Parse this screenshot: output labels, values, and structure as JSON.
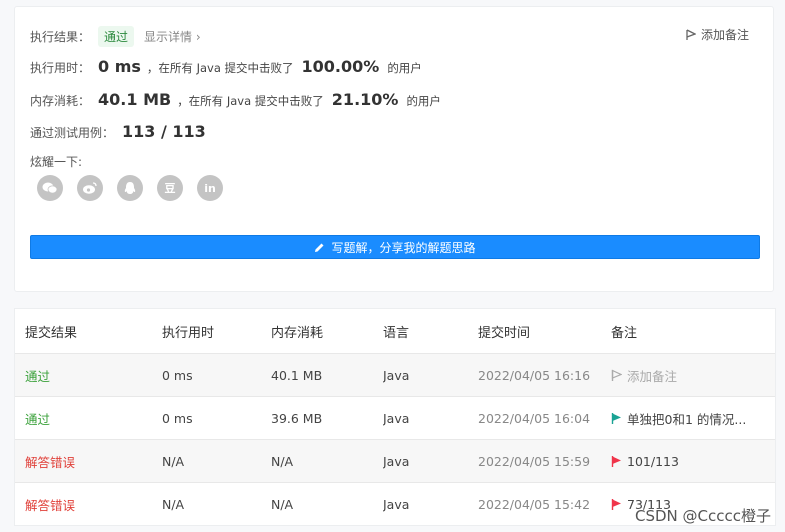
{
  "result": {
    "label": "执行结果：",
    "status": "通过",
    "details_link": "显示详情 ›",
    "add_note": "添加备注"
  },
  "runtime": {
    "label": "执行用时：",
    "value": "0 ms",
    "mid_text": "，在所有 Java 提交中击败了",
    "percent": "100.00%",
    "suffix": "的用户"
  },
  "memory": {
    "label": "内存消耗：",
    "value": "40.1 MB",
    "mid_text": "，在所有 Java 提交中击败了",
    "percent": "21.10%",
    "suffix": "的用户"
  },
  "testcases": {
    "label": "通过测试用例：",
    "value": "113 / 113"
  },
  "share": {
    "label": "炫耀一下:",
    "icons": [
      "wechat-icon",
      "weibo-icon",
      "qq-icon",
      "douban-icon",
      "linkedin-icon"
    ],
    "douban_glyph": "豆",
    "linkedin_glyph": "in"
  },
  "solution_button": "写题解，分享我的解题思路",
  "submissions": {
    "headers": [
      "提交结果",
      "执行用时",
      "内存消耗",
      "语言",
      "提交时间",
      "备注"
    ],
    "rows": [
      {
        "result": "通过",
        "runtime": "0 ms",
        "memory": "40.1 MB",
        "lang": "Java",
        "time": "2022/04/05 16:16",
        "note": "添加备注",
        "flag": "#aaaaaa"
      },
      {
        "result": "通过",
        "runtime": "0 ms",
        "memory": "39.6 MB",
        "lang": "Java",
        "time": "2022/04/05 16:04",
        "note": "单独把0和1 的情况...",
        "flag": "#1aa394"
      },
      {
        "result": "解答错误",
        "runtime": "N/A",
        "memory": "N/A",
        "lang": "Java",
        "time": "2022/04/05 15:59",
        "note": "101/113",
        "flag": "#f0344a"
      },
      {
        "result": "解答错误",
        "runtime": "N/A",
        "memory": "N/A",
        "lang": "Java",
        "time": "2022/04/05 15:42",
        "note": "73/113",
        "flag": "#f0344a"
      }
    ]
  },
  "watermark": "CSDN @Ccccc橙子",
  "colors": {
    "accent": "#1a8cff",
    "success": "#3aa13a",
    "error": "#e0413a"
  }
}
